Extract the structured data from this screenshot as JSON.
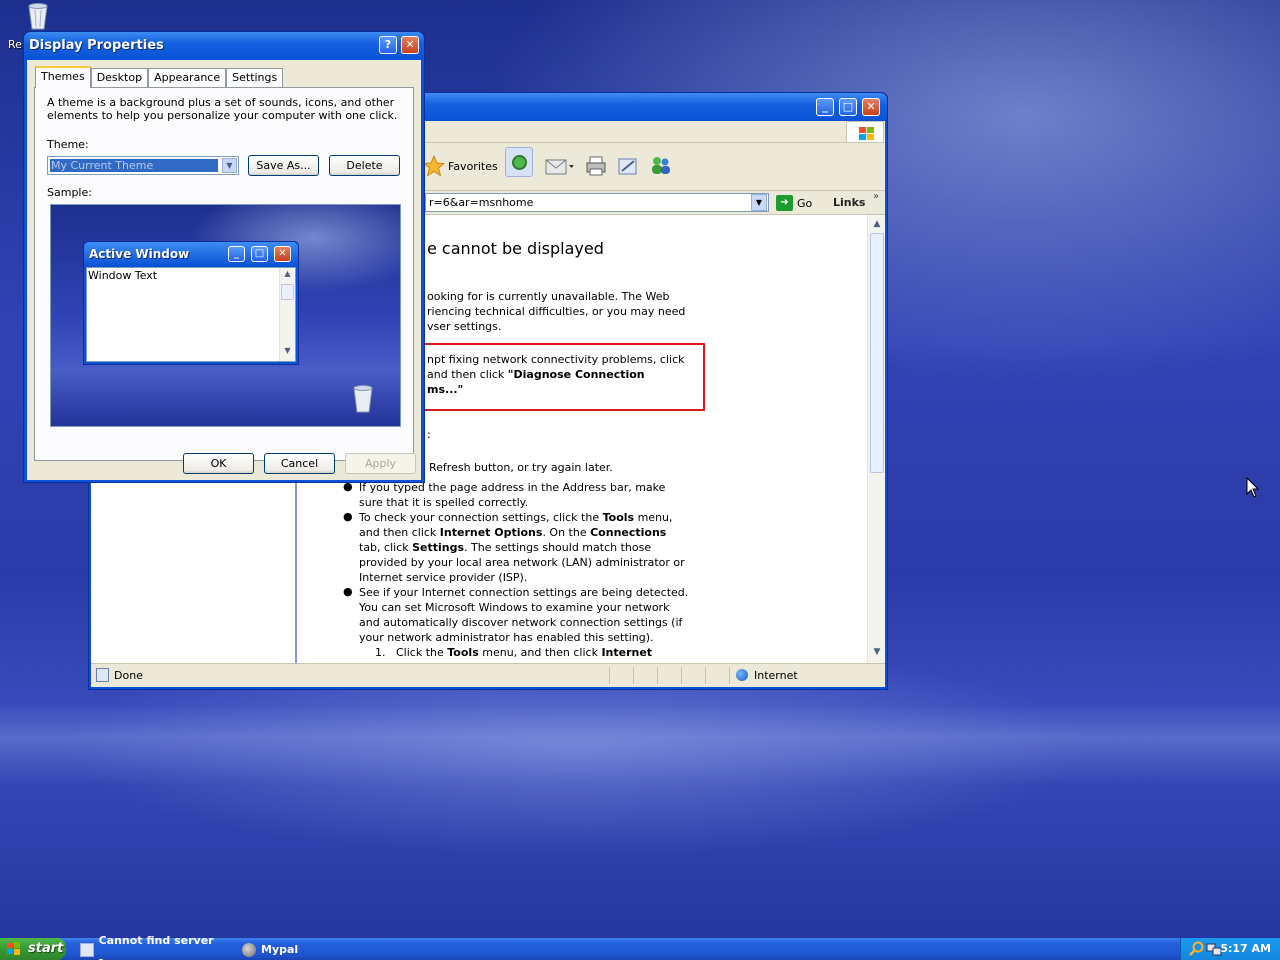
{
  "colors": {
    "xp_blue": "#0a53d9",
    "start_green": "#3a9b37",
    "highlight_red": "#d61c1c",
    "selection": "#316ac5"
  },
  "desktop": {
    "icon": {
      "name": "recycle-bin-icon",
      "label": "Re"
    }
  },
  "ie_window": {
    "title_buttons": [
      "minimize",
      "maximize",
      "close"
    ],
    "toolbar": {
      "favorites_label": "Favorites"
    },
    "address": {
      "value": "r=6&ar=msnhome",
      "go_label": "Go",
      "links_label": "Links",
      "links_chevron": "»"
    },
    "page": {
      "heading": "e cannot be displayed",
      "para1": [
        "ooking for is currently unavailable. The Web",
        "riencing technical difficulties, or you may need",
        "vser settings."
      ],
      "box_line1": "npt fixing network connectivity problems, click",
      "box_line2_pre": "and then click ",
      "box_line2_bold": "\"Diagnose Connection",
      "box_line3": "ms...\"",
      "colon": ":",
      "refresh_line": "Refresh button, or try again later.",
      "bullet1": [
        "If you typed the page address in the Address bar, make",
        "sure that it is spelled correctly."
      ],
      "bullet2_l1_pre": "To check your connection settings, click the ",
      "bullet2_l1_bold": "Tools",
      "bullet2_l1_post": " menu,",
      "bullet2_l2_pre": "and then click ",
      "bullet2_l2_bold1": "Internet Options",
      "bullet2_l2_mid": ". On the ",
      "bullet2_l2_bold2": "Connections",
      "bullet2_l3_pre": "tab, click ",
      "bullet2_l3_bold": "Settings",
      "bullet2_l3_post": ". The settings should match those",
      "bullet2_l4": "provided by your local area network (LAN) administrator or",
      "bullet2_l5": "Internet service provider (ISP).",
      "bullet3": [
        "See if your Internet connection settings are being detected.",
        "You can set Microsoft Windows to examine your network",
        "and automatically discover network connection settings (if",
        "your network administrator has enabled this setting)."
      ],
      "sub1_num": "1.",
      "sub1_pre": "Click the ",
      "sub1_bold1": "Tools",
      "sub1_mid": " menu, and then click ",
      "sub1_bold2": "Internet"
    },
    "status": {
      "left": "Done",
      "zone": "Internet"
    }
  },
  "dialog": {
    "title": "Display Properties",
    "help_btn": "?",
    "close_btn": "✕",
    "tabs": [
      "Themes",
      "Desktop",
      "Appearance",
      "Settings"
    ],
    "description": "A theme is a background plus a set of sounds, icons, and other elements to help you personalize your computer with one click.",
    "theme_label": "Theme:",
    "theme_value": "My Current Theme",
    "save_as": "Save As...",
    "delete": "Delete",
    "sample_label": "Sample:",
    "sample_window": {
      "title": "Active Window",
      "text": "Window Text"
    },
    "ok": "OK",
    "cancel": "Cancel",
    "apply": "Apply"
  },
  "taskbar": {
    "start": "start",
    "items": [
      {
        "label": "Cannot find server -..."
      },
      {
        "label": "Mypal"
      }
    ],
    "clock": "5:17 AM"
  }
}
